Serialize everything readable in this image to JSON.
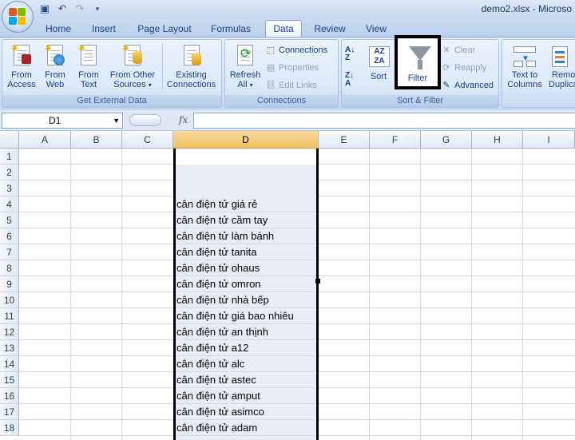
{
  "window": {
    "title": "demo2.xlsx - Microso"
  },
  "quick_access": {
    "icons": [
      "save-icon",
      "undo-icon",
      "redo-icon",
      "customize-icon"
    ]
  },
  "tabs": [
    {
      "label": "Home"
    },
    {
      "label": "Insert"
    },
    {
      "label": "Page Layout"
    },
    {
      "label": "Formulas"
    },
    {
      "label": "Data",
      "active": true
    },
    {
      "label": "Review"
    },
    {
      "label": "View"
    }
  ],
  "ribbon": {
    "get_external_data": {
      "label": "Get External Data",
      "from_access": {
        "line1": "From",
        "line2": "Access"
      },
      "from_web": {
        "line1": "From",
        "line2": "Web"
      },
      "from_text": {
        "line1": "From",
        "line2": "Text"
      },
      "from_other": {
        "line1": "From Other",
        "line2": "Sources"
      },
      "existing": {
        "line1": "Existing",
        "line2": "Connections"
      }
    },
    "connections": {
      "label": "Connections",
      "refresh": {
        "line1": "Refresh",
        "line2": "All"
      },
      "connections": "Connections",
      "properties": "Properties",
      "edit_links": "Edit Links"
    },
    "sort_filter": {
      "label": "Sort & Filter",
      "sort": "Sort",
      "filter": "Filter",
      "clear": "Clear",
      "reapply": "Reapply",
      "advanced": "Advanced"
    },
    "data_tools": {
      "text_to_columns": {
        "line1": "Text to",
        "line2": "Columns"
      },
      "remove_dup": {
        "line1": "Remo",
        "line2": "Duplica"
      }
    }
  },
  "formula_bar": {
    "name_box": "D1",
    "fx": "fx",
    "value": ""
  },
  "grid": {
    "columns": [
      "A",
      "B",
      "C",
      "D",
      "E",
      "F",
      "G",
      "H",
      "I"
    ],
    "selected_column": "D",
    "rows": [
      "1",
      "2",
      "3",
      "4",
      "5",
      "6",
      "7",
      "8",
      "9",
      "10",
      "11",
      "12",
      "13",
      "14",
      "15",
      "16",
      "17",
      "18"
    ],
    "column_d_values": [
      "",
      "",
      "",
      "cân điện tử giá rẻ",
      "cân điện tử cầm tay",
      "cân điện tử làm bánh",
      "cân điện tử tanita",
      "cân điện tử ohaus",
      "cân điện tử omron",
      "cân điện tử nhà bếp",
      "cân điện tử giá bao nhiêu",
      "cân điện tử an thịnh",
      "cân điện tử a12",
      "cân điện tử alc",
      "cân điện tử astec",
      "cân điện tử amput",
      "cân điện tử asimco",
      "cân điện tử adam"
    ]
  }
}
